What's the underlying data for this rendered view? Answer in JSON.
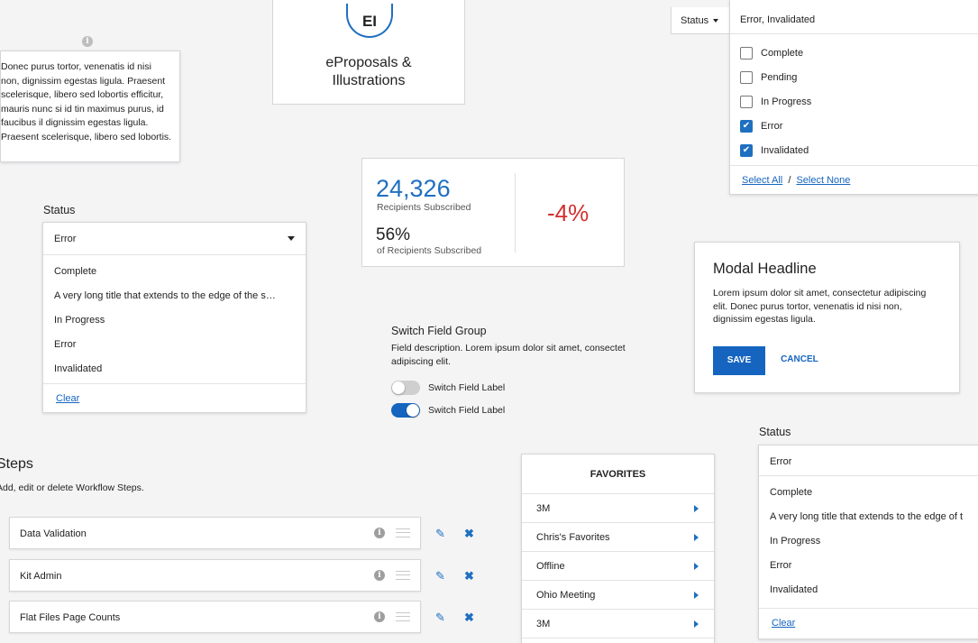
{
  "tooltip": {
    "text": "Donec purus tortor, venenatis id nisi non, dignissim egestas ligula. Praesent scelerisque, libero sed lobortis efficitur, mauris nunc si id tin maximus purus, id faucibus il dignissim egestas ligula. Praesent scelerisque, libero sed lobortis."
  },
  "logo": {
    "initials": "EI",
    "title_line1": "eProposals &",
    "title_line2": "Illustrations"
  },
  "status_left": {
    "label": "Status",
    "value": "Error",
    "options": [
      "Complete",
      "A very long title that extends to the edge of the s…",
      "In Progress",
      "Error",
      "Invalidated"
    ],
    "clear_label": "Clear"
  },
  "stats": {
    "recipients_count": "24,326",
    "recipients_label": "Recipients Subscribed",
    "percent": "56%",
    "percent_label": "of Recipients Subscribed",
    "change": "-4%"
  },
  "status_filter": {
    "trigger_label": "Status",
    "value": "Error, Invalidated",
    "options": [
      {
        "label": "Complete",
        "checked": false
      },
      {
        "label": "Pending",
        "checked": false
      },
      {
        "label": "In Progress",
        "checked": false
      },
      {
        "label": "Error",
        "checked": true
      },
      {
        "label": "Invalidated",
        "checked": true
      }
    ],
    "select_all": "Select All",
    "separator": "/",
    "select_none": "Select None"
  },
  "modal": {
    "title": "Modal Headline",
    "body": "Lorem ipsum dolor sit amet, consectetur adipiscing elit. Donec purus tortor, venenatis id nisi non, dignissim egestas ligula.",
    "save": "SAVE",
    "cancel": "CANCEL"
  },
  "switch_group": {
    "title": "Switch Field Group",
    "description": "Field description. Lorem ipsum dolor sit amet, consectet adipiscing elit.",
    "switches": [
      {
        "label": "Switch Field Label",
        "on": false
      },
      {
        "label": "Switch Field Label",
        "on": true
      }
    ]
  },
  "status_right": {
    "label": "Status",
    "value": "Error",
    "options": [
      "Complete",
      "A very long title that extends to the edge of t",
      "In Progress",
      "Error",
      "Invalidated"
    ],
    "clear_label": "Clear"
  },
  "steps": {
    "title": "Steps",
    "description": "Add, edit or delete Workflow Steps.",
    "rows": [
      "Data Validation",
      "Kit Admin",
      "Flat Files Page Counts"
    ]
  },
  "favorites": {
    "title": "FAVORITES",
    "items": [
      "3M",
      "Chris's Favorites",
      "Offline",
      "Ohio Meeting",
      "3M"
    ]
  },
  "colors": {
    "primary": "#1565c0",
    "negative": "#d32f2f",
    "background": "#f4f4f5"
  }
}
